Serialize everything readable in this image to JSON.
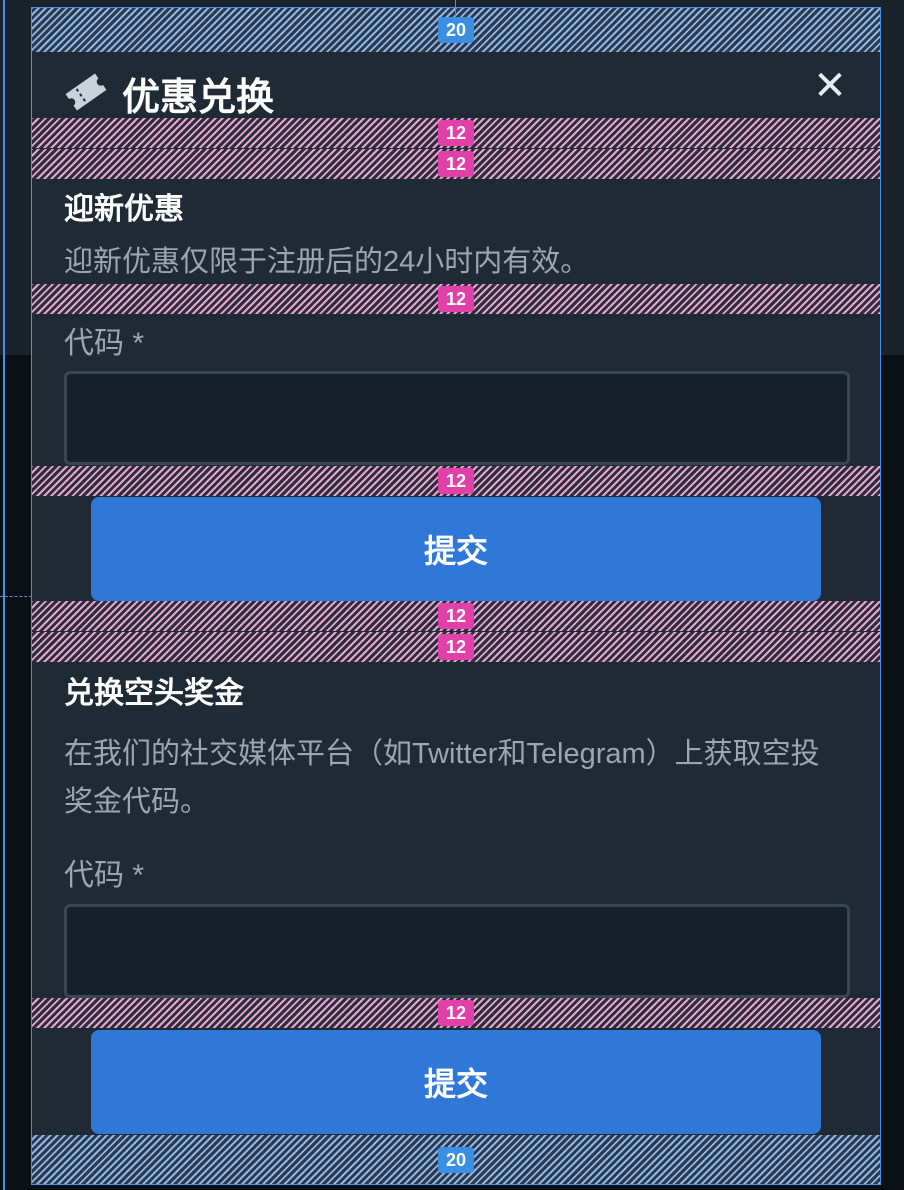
{
  "modal": {
    "title": "优惠兑换",
    "close_symbol": "✕",
    "icon": "ticket-icon"
  },
  "spacing_tags": {
    "top": "20",
    "header_gap_1": "12",
    "header_gap_2": "12",
    "desc_gap_1": "12",
    "input_gap_1": "12",
    "section_gap_1": "12",
    "section_gap_2": "12",
    "input_gap_2": "12",
    "bottom": "20"
  },
  "sections": [
    {
      "title": "迎新优惠",
      "description": "迎新优惠仅限于注册后的24小时内有效。",
      "field_label": "代码 *",
      "input_value": "",
      "submit_label": "提交"
    },
    {
      "title": "兑换空头奖金",
      "description": "在我们的社交媒体平台（如Twitter和Telegram）上获取空投奖金代码。",
      "field_label": "代码 *",
      "input_value": "",
      "submit_label": "提交"
    }
  ],
  "colors": {
    "modal_bg": "#1f2a35",
    "button": "#2f78d8",
    "input_bg": "#16202a",
    "guide": "#4a90e2",
    "tag_pink": "#e040a8"
  }
}
